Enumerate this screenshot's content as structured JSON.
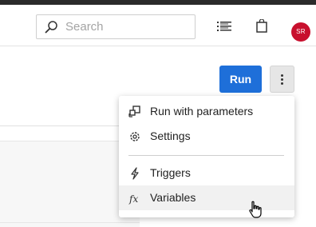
{
  "header": {
    "search": {
      "placeholder": "Search",
      "icon": "search-icon"
    },
    "list_icon": "list-icon",
    "bag_icon": "shopping-bag-icon",
    "avatar_initials": "SR",
    "avatar_color": "#c8102e"
  },
  "actions": {
    "run_label": "Run",
    "run_color": "#1e6fd9",
    "more_icon": "more-vertical-icon"
  },
  "menu": {
    "items": [
      {
        "label": "Run with parameters",
        "icon": "run-with-parameters-icon"
      },
      {
        "label": "Settings",
        "icon": "gear-icon"
      },
      {
        "label": "Triggers",
        "icon": "lightning-icon"
      },
      {
        "label": "Variables",
        "icon": "fx-icon",
        "hovered": true
      }
    ]
  }
}
